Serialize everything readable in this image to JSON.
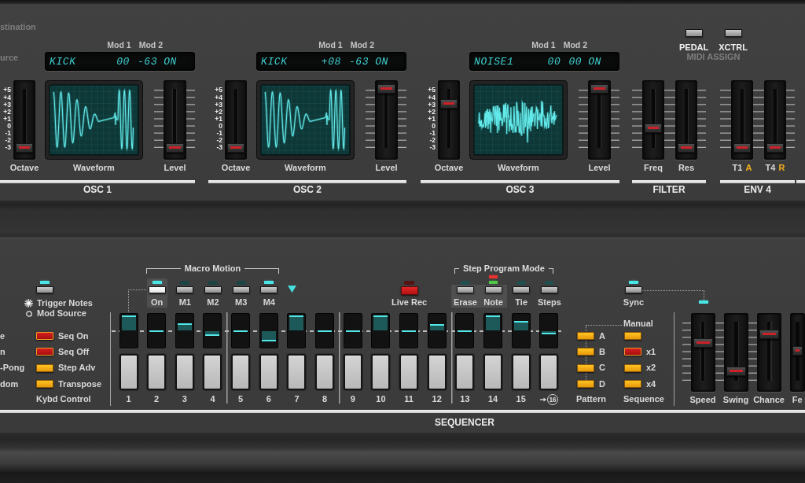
{
  "top_left_labels": [
    "stination",
    "urce"
  ],
  "oscillators": [
    {
      "title": "OSC 1",
      "mod_labels": [
        "Mod 1",
        "Mod 2"
      ],
      "display": {
        "name": "KICK",
        "values": [
          "00",
          "-63",
          "ON"
        ]
      },
      "octave": {
        "label": "Octave",
        "scale": [
          "+5",
          "+4",
          "+3",
          "+2",
          "+1",
          "0",
          "-1",
          "-2",
          "-3"
        ],
        "level": 0
      },
      "waveform": {
        "label": "Waveform",
        "kind": "kick"
      },
      "level": {
        "label": "Level",
        "level": 0
      }
    },
    {
      "title": "OSC 2",
      "mod_labels": [
        "Mod 1",
        "Mod 2"
      ],
      "display": {
        "name": "KICK",
        "values": [
          "+08",
          "-63",
          "ON"
        ]
      },
      "octave": {
        "label": "Octave",
        "scale": [
          "+5",
          "+4",
          "+3",
          "+2",
          "+1",
          "0",
          "-1",
          "-2",
          "-3"
        ],
        "level": 0
      },
      "waveform": {
        "label": "Waveform",
        "kind": "kick"
      },
      "level": {
        "label": "Level",
        "level": 1
      }
    },
    {
      "title": "OSC 3",
      "mod_labels": [
        "Mod 1",
        "Mod 2"
      ],
      "display": {
        "name": "NOISE1",
        "values": [
          "00",
          "00",
          "ON"
        ]
      },
      "octave": {
        "label": "Octave",
        "scale": [
          "+5",
          "+4",
          "+3",
          "+2",
          "+1",
          "0",
          "-1",
          "-2",
          "-3"
        ],
        "level": 0.75
      },
      "waveform": {
        "label": "Waveform",
        "kind": "noise"
      },
      "level": {
        "label": "Level",
        "level": 1
      }
    }
  ],
  "midi_assign": {
    "buttons": [
      "PEDAL",
      "XCTRL"
    ],
    "title": "MIDI ASSIGN"
  },
  "filter": {
    "title": "FILTER",
    "sliders": [
      {
        "label": "Freq",
        "level": 0.34
      },
      {
        "label": "Res",
        "level": 0
      }
    ]
  },
  "env": {
    "title": "ENV 4",
    "sliders": [
      {
        "label": "T1",
        "tag": "A",
        "level": 0
      },
      {
        "label": "T4",
        "tag": "R",
        "level": 0
      }
    ]
  },
  "sequencer": {
    "title": "SEQUENCER",
    "left_labels": [
      "e",
      "n",
      "-Pong",
      "dom"
    ],
    "trigger": {
      "led_on": true,
      "options": [
        {
          "label": "Trigger Notes",
          "selected": true
        },
        {
          "label": "Mod Source",
          "selected": false
        }
      ]
    },
    "kybd_control": {
      "title": "Kybd Control",
      "buttons": [
        {
          "label": "Seq On",
          "on": true
        },
        {
          "label": "Seq Off",
          "on": true
        },
        {
          "label": "Step Adv",
          "on": false
        },
        {
          "label": "Transpose",
          "on": false
        }
      ]
    },
    "macro_motion": {
      "title": "Macro Motion",
      "buttons": [
        {
          "label": "On",
          "led_on": true,
          "selected": true
        },
        {
          "label": "M1",
          "led_on": false,
          "selected": false
        },
        {
          "label": "M2",
          "led_on": false,
          "selected": false
        },
        {
          "label": "M3",
          "led_on": false,
          "selected": false
        },
        {
          "label": "M4",
          "led_on": true,
          "selected": false
        }
      ]
    },
    "live_rec": {
      "label": "Live Rec",
      "led_on": false
    },
    "step_program_mode": {
      "title": "Step Program Mode",
      "buttons": [
        {
          "label": "Erase",
          "selected": true,
          "leds": [
            {
              "on": false,
              "color": "#1f4f4f"
            }
          ]
        },
        {
          "label": "Note",
          "selected": true,
          "leds": [
            {
              "on": true,
              "color": "#e8332f"
            },
            {
              "on": true,
              "color": "#4fc84a"
            }
          ]
        },
        {
          "label": "Tie",
          "selected": false,
          "leds": [
            {
              "on": false,
              "color": "#1f4f4f"
            }
          ]
        },
        {
          "label": "Steps",
          "selected": false,
          "leds": [
            {
              "on": false,
              "color": "#1f4f4f"
            }
          ]
        }
      ]
    },
    "steps": [
      {
        "number": "1",
        "level": 0.92,
        "end": false
      },
      {
        "number": "2",
        "level": 0.5,
        "end": false
      },
      {
        "number": "3",
        "level": 0.7,
        "end": false
      },
      {
        "number": "4",
        "level": 0.37,
        "end": false
      },
      {
        "number": "5",
        "level": 0.5,
        "end": false
      },
      {
        "number": "6",
        "level": 0.21,
        "end": false
      },
      {
        "number": "7",
        "level": 0.92,
        "end": false
      },
      {
        "number": "8",
        "level": 0.5,
        "end": false
      },
      {
        "number": "9",
        "level": 0.5,
        "end": false
      },
      {
        "number": "10",
        "level": 0.92,
        "end": false
      },
      {
        "number": "11",
        "level": 0.5,
        "end": false
      },
      {
        "number": "12",
        "level": 0.67,
        "end": false
      },
      {
        "number": "13",
        "level": 0.5,
        "end": false
      },
      {
        "number": "14",
        "level": 0.92,
        "end": false
      },
      {
        "number": "15",
        "level": 0.76,
        "end": false
      },
      {
        "number": "16",
        "level": 0.43,
        "end": true
      }
    ],
    "sync": {
      "label": "Sync",
      "led_on": true
    },
    "pattern": {
      "title": "Pattern",
      "buttons": [
        "A",
        "B",
        "C",
        "D"
      ]
    },
    "sequence": {
      "title": "Sequence",
      "manual": {
        "label": "Manual",
        "on": false
      },
      "buttons": [
        {
          "label": "x1",
          "on": true
        },
        {
          "label": "x2",
          "on": false
        },
        {
          "label": "x4",
          "on": false
        }
      ]
    },
    "sliders": [
      {
        "label": "Speed",
        "level": 0.64,
        "linked": true,
        "ticks": true
      },
      {
        "label": "Swing",
        "level": 0.16,
        "linked": false,
        "ticks": true
      },
      {
        "label": "Chance",
        "level": 0.79,
        "linked": false,
        "ticks": true
      },
      {
        "label": "Fe",
        "level": 0.51,
        "linked": false,
        "ticks": false
      }
    ]
  }
}
